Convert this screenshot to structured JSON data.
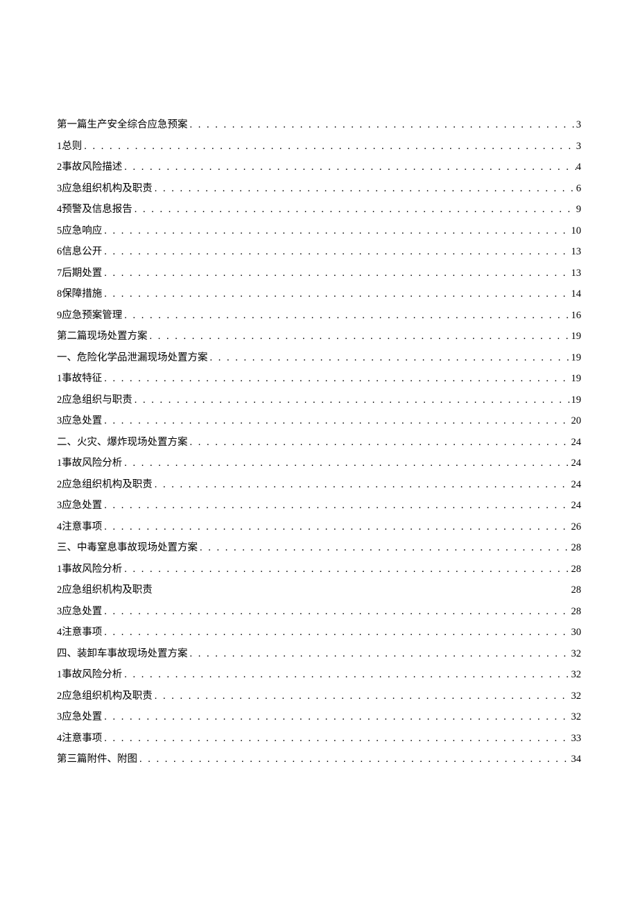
{
  "toc": {
    "entries": [
      {
        "title": "第一篇生产安全综合应急预案",
        "page": "3",
        "dots": true
      },
      {
        "title": "1总则",
        "page": "3",
        "dots": true
      },
      {
        "title": "2事故风险描述",
        "page": "4",
        "dots": true
      },
      {
        "title": "3应急组织机构及职责",
        "page": "6",
        "dots": true
      },
      {
        "title": "4预警及信息报告",
        "page": "9",
        "dots": true
      },
      {
        "title": "5应急响应",
        "page": "10",
        "dots": true
      },
      {
        "title": "6信息公开",
        "page": "13",
        "dots": true
      },
      {
        "title": "7后期处置",
        "page": "13",
        "dots": true
      },
      {
        "title": "8保障措施",
        "page": "14",
        "dots": true
      },
      {
        "title": "9应急预案管理",
        "page": "16",
        "dots": true
      },
      {
        "title": "第二篇现场处置方案",
        "page": "19",
        "dots": true
      },
      {
        "title": "一、危险化学品泄漏现场处置方案",
        "page": "19",
        "dots": true
      },
      {
        "title": "1事故特征",
        "page": "19",
        "dots": true
      },
      {
        "title": "2应急组织与职责",
        "page": "19",
        "dots": true
      },
      {
        "title": "3应急处置",
        "page": "20",
        "dots": true
      },
      {
        "title": "二、火灾、爆炸现场处置方案",
        "page": "24",
        "dots": true
      },
      {
        "title": "1事故风险分析",
        "page": "24",
        "dots": true
      },
      {
        "title": "2应急组织机构及职责",
        "page": "24",
        "dots": true
      },
      {
        "title": "3应急处置",
        "page": "24",
        "dots": true
      },
      {
        "title": "4注意事项",
        "page": "26",
        "dots": true
      },
      {
        "title": "三、中毒窒息事故现场处置方案",
        "page": "28",
        "dots": true
      },
      {
        "title": "1事故风险分析",
        "page": "28",
        "dots": true
      },
      {
        "title": "2应急组织机构及职责",
        "page": "28",
        "dots": false
      },
      {
        "title": "3应急处置",
        "page": "28",
        "dots": true
      },
      {
        "title": "4注意事项",
        "page": "30",
        "dots": true
      },
      {
        "title": "四、装卸车事故现场处置方案",
        "page": "32",
        "dots": true
      },
      {
        "title": "1事故风险分析",
        "page": "32",
        "dots": true
      },
      {
        "title": "2应急组织机构及职责",
        "page": "32",
        "dots": true
      },
      {
        "title": "3应急处置",
        "page": "32",
        "dots": true
      },
      {
        "title": "4注意事项",
        "page": "33",
        "dots": true
      },
      {
        "title": "第三篇附件、附图",
        "page": "34",
        "dots": true
      }
    ]
  }
}
